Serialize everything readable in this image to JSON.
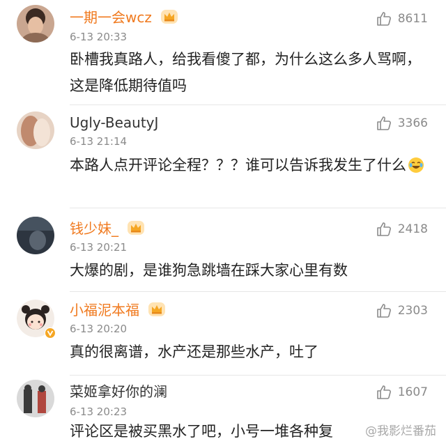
{
  "comments": [
    {
      "username": "一期一会wcz",
      "time": "6-13 20:33",
      "likes": "8611",
      "text": "卧槽我真路人，给我看傻了都，为什么这么多人骂啊，这是降低期待值吗",
      "vip": true
    },
    {
      "username": "Ugly-BeautyJ",
      "time": "6-13 21:14",
      "likes": "3366",
      "text": "本路人点开评论全程？？？谁可以告诉我发生了什么",
      "emoji": "laugh-cry-emoji",
      "vip": false
    },
    {
      "username": "钱少妹_",
      "time": "6-13 20:21",
      "likes": "2418",
      "text": "大爆的剧，是谁狗急跳墙在踩大家心里有数",
      "vip": true
    },
    {
      "username": "小福泥本福",
      "time": "6-13 20:20",
      "likes": "2303",
      "text": "真的很离谱，水产还是那些水产，吐了",
      "vip": true,
      "verified": true
    },
    {
      "username": "菜姬拿好你的澜",
      "time": "6-13 20:23",
      "likes": "1607",
      "text": "评论区是被买黑水了吧，小号一堆各种复",
      "vip": false
    }
  ],
  "watermark": "@我影烂番茄",
  "colors": {
    "vip_name": "#f07a1f",
    "text": "#222222",
    "meta": "#8a8a8a",
    "divider": "#e6e6e6"
  }
}
